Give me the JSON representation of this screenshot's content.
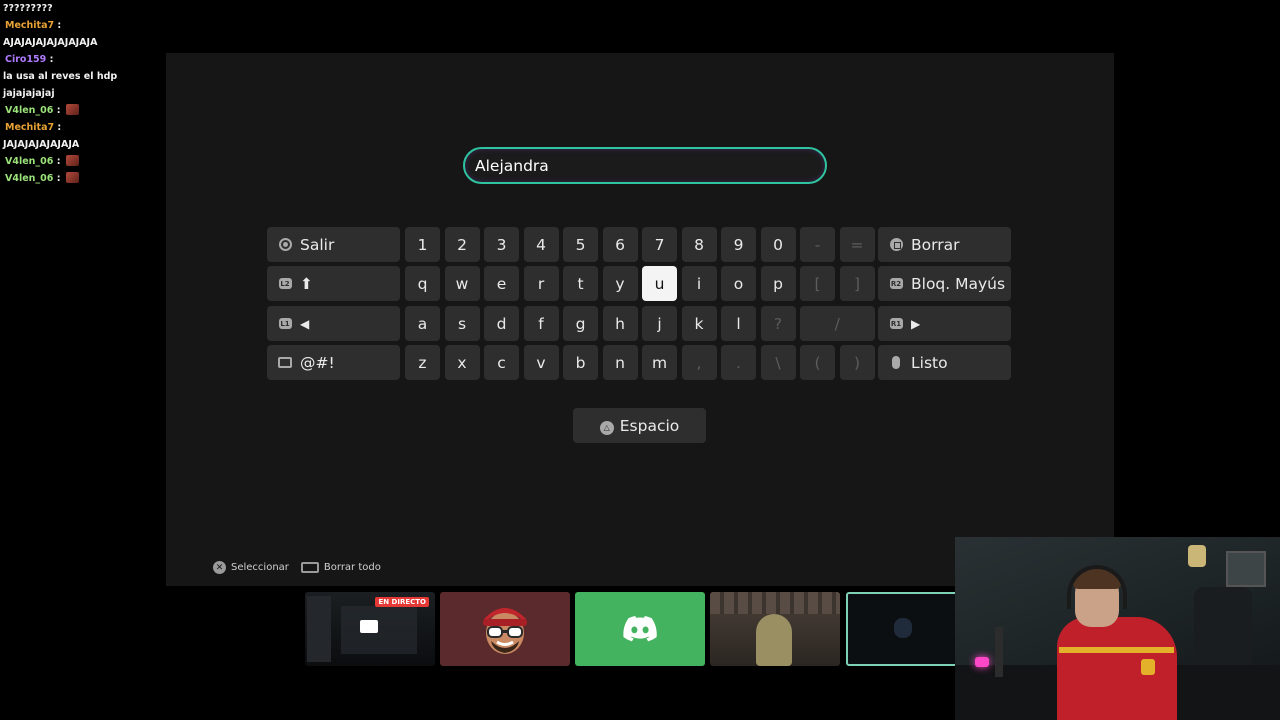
{
  "chat": {
    "messages": [
      {
        "user": "",
        "text": "?????????",
        "user_color": ""
      },
      {
        "user": "Mechita7",
        "text": "AJAJAJAJAJAJAJAJA",
        "user_color": "#e8a235"
      },
      {
        "user": "Ciro159",
        "text": "la usa al reves el hdp jajajajajaj",
        "user_color": "#b07cff"
      },
      {
        "user": "V4len_06",
        "text": "",
        "user_color": "#9be27a",
        "emote": true
      },
      {
        "user": "Mechita7",
        "text": "JAJAJAJAJAJAJA",
        "user_color": "#e8a235"
      },
      {
        "user": "V4len_06",
        "text": "",
        "user_color": "#9be27a",
        "emote": true
      },
      {
        "user": "V4len_06",
        "text": "",
        "user_color": "#9be27a",
        "emote": true
      }
    ]
  },
  "keyboard": {
    "input_value": "Alejandra",
    "salir": "Salir",
    "borrar": "Borrar",
    "bloq": "Bloq. Mayús",
    "listo": "Listo",
    "symbols": "@#!",
    "space": "Espacio",
    "shift_glyph": "⬆",
    "left_glyph": "◀",
    "right_glyph": "▶",
    "row1": [
      "1",
      "2",
      "3",
      "4",
      "5",
      "6",
      "7",
      "8",
      "9",
      "0",
      "-",
      "="
    ],
    "row2": [
      "q",
      "w",
      "e",
      "r",
      "t",
      "y",
      "u",
      "i",
      "o",
      "p",
      "[",
      "]"
    ],
    "row3": [
      "a",
      "s",
      "d",
      "f",
      "g",
      "h",
      "j",
      "k",
      "l",
      "?",
      "/"
    ],
    "row4": [
      "z",
      "x",
      "c",
      "v",
      "b",
      "n",
      "m",
      ",",
      ".",
      "\\",
      "(",
      ")"
    ],
    "selected_key": "u",
    "dim_keys": [
      "-",
      "=",
      "[",
      "]",
      "?",
      "/",
      ",",
      ".",
      "\\",
      "(",
      ")"
    ],
    "l1_label": "L1",
    "r1_label": "R1",
    "r2_label": "R2",
    "l2_label": "L2",
    "hints": [
      {
        "icon": "cross-icon",
        "label": "Seleccionar"
      },
      {
        "icon": "touchpad-icon",
        "label": "Borrar todo"
      }
    ]
  },
  "thumbnails": {
    "live_badge": "EN DIRECTO",
    "discord_color": "#44b35f",
    "selected_border": "#7fd1b4"
  },
  "colors": {
    "input_border": "#2fc4a0",
    "key_bg": "#2e2e2e",
    "key_selected_bg": "#f4f4f4",
    "panel_bg": "#161616"
  }
}
